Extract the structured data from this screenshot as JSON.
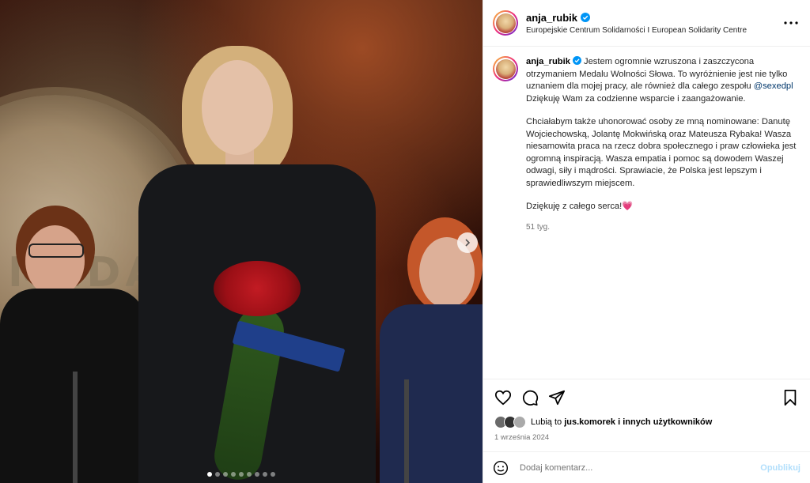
{
  "post": {
    "username": "anja_rubik",
    "location": "Europejskie Centrum Solidarności I European Solidarity Centre",
    "caption": {
      "username": "anja_rubik",
      "line1_before_mention": "Jestem ogromnie wzruszona i zaszczycona otrzymaniem Medalu Wolności Słowa. To wyróżnienie jest nie tylko uznaniem dla mojej pracy, ale również dla całego zespołu",
      "mention": "@sexedpl",
      "line1_after_mention": "Dziękuję Wam za codzienne wsparcie i zaangażowanie.",
      "paragraph2": "Chciałabym także uhonorować osoby ze mną nominowane: Danutę Wojciechowską, Jolantę Mokwińską oraz Mateusza Rybaka! Wasza niesamowita praca na rzecz dobra społecznego i praw człowieka jest ogromną inspiracją. Wasza empatia i pomoc są dowodem Waszej odwagi, siły i mądrości. Sprawiacie, że Polska jest lepszym i sprawiedliwszym miejscem.",
      "paragraph3": "Dziękuję z całego serca!💗",
      "time": "51 tyg."
    },
    "likes": {
      "prefix": "Lubią to",
      "user": "jus.komorek",
      "suffix": "i innych użytkowników"
    },
    "date": "1 września 2024",
    "comment": {
      "placeholder": "Dodaj komentarz...",
      "publish_label": "Opublikuj"
    },
    "carousel": {
      "count": 9,
      "active_index": 0
    },
    "colors": {
      "verified": "#0095f6",
      "mention": "#00376b",
      "publish_disabled": "#b2dffc"
    }
  }
}
